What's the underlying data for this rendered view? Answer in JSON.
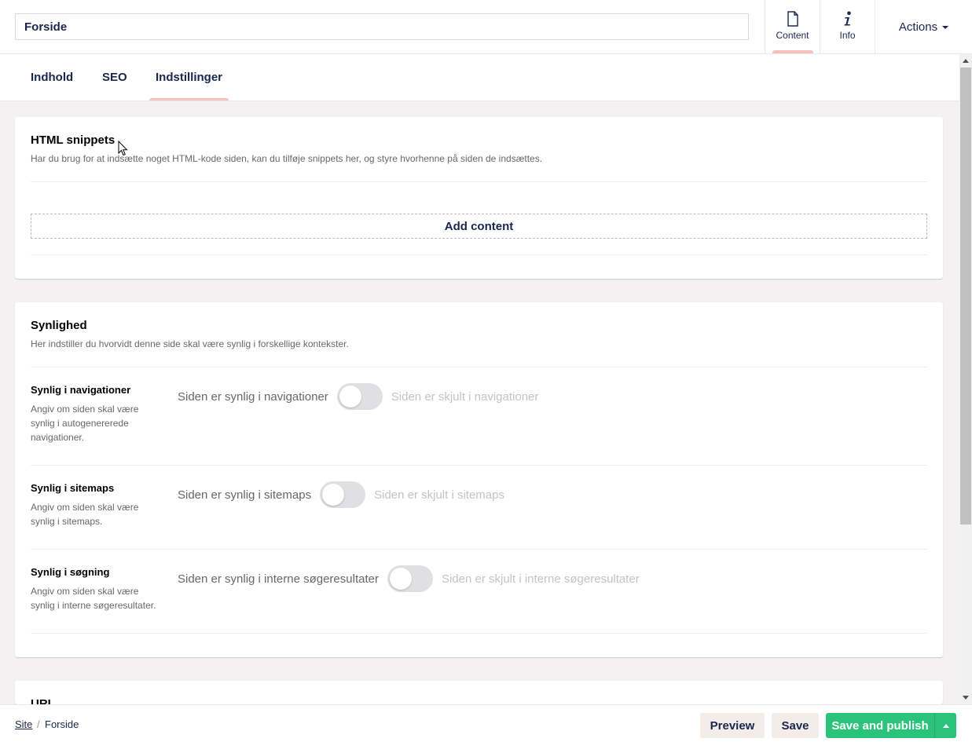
{
  "header": {
    "name_value": "Forside",
    "apps": [
      {
        "label": "Content",
        "icon": "document-icon",
        "active": true
      },
      {
        "label": "Info",
        "icon": "info-icon",
        "active": false
      }
    ],
    "actions_label": "Actions"
  },
  "tabs": [
    {
      "label": "Indhold",
      "active": false
    },
    {
      "label": "SEO",
      "active": false
    },
    {
      "label": "Indstillinger",
      "active": true
    }
  ],
  "html_snippets": {
    "title": "HTML snippets",
    "description": "Har du brug for at indsætte noget HTML-kode siden, kan du tilføje snippets her, og styre hvorhenne på siden de indsættes.",
    "add_content_label": "Add content"
  },
  "visibility": {
    "title": "Synlighed",
    "description": "Her indstiller du hvorvidt denne side skal være synlig i forskellige kontekster.",
    "properties": [
      {
        "label": "Synlig i navigationer",
        "desc_lines": [
          "Angiv om siden skal være",
          "synlig i autogenererede",
          "navigationer."
        ],
        "on_label": "Siden er synlig i navigationer",
        "off_label": "Siden er skjult i navigationer",
        "toggled": false
      },
      {
        "label": "Synlig i sitemaps",
        "desc_lines": [
          "Angiv om siden skal være",
          "synlig i sitemaps."
        ],
        "on_label": "Siden er synlig i sitemaps",
        "off_label": "Siden er skjult i sitemaps",
        "toggled": false
      },
      {
        "label": "Synlig i søgning",
        "desc_lines": [
          "Angiv om siden skal være",
          "synlig i interne søgeresultater."
        ],
        "on_label": "Siden er synlig i interne søgeresultater",
        "off_label": "Siden er skjult i interne søgeresultater",
        "toggled": false
      }
    ]
  },
  "url_panel": {
    "title": "URL"
  },
  "footer": {
    "breadcrumb": [
      "Site",
      "Forside"
    ],
    "breadcrumb_separator": "/",
    "preview_label": "Preview",
    "save_label": "Save",
    "save_publish_label": "Save and publish"
  },
  "colors": {
    "accent": "#f5c1bc",
    "publish": "#2bc37c",
    "text": "#1b264f"
  }
}
